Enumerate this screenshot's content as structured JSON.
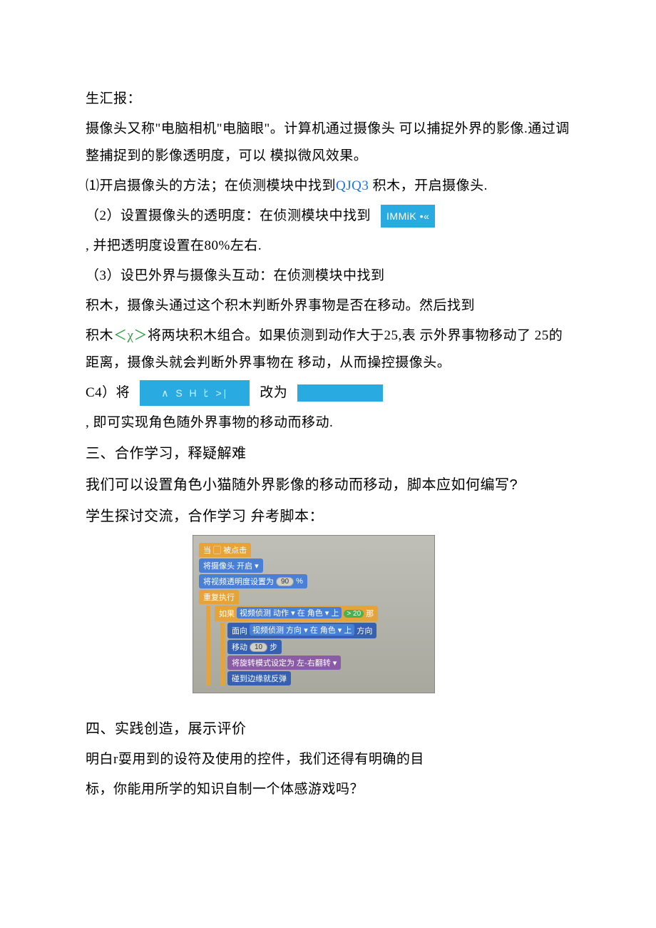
{
  "p1": "生汇报：",
  "p2": "摄像头又称\"电脑相机\"电脑眼\"。计算机通过摄像头 可以捕捉外界的影像.通过调整捕捉到的影像透明度，可以 模拟微风效果。",
  "p3_a": "⑴开启摄像头的方法；在侦测模块中找到",
  "p3_link": "QJQ3",
  "p3_b": " 积木，开启摄像头.",
  "p4_a": "（2）设置摄像头的透明度：在侦测模块中找到",
  "p4_badge": "IMMiK •«",
  "p5": ", 并把透明度设置在80%左右.",
  "p6": "（3）设巴外界与摄像头互动：在侦测模块中找到",
  "p7": "积木，摄像头通过这个积木判断外界事物是否在移动。然后找到",
  "p8_a": "积木",
  "p8_green": "＜χ＞",
  "p8_b": "将两块积木组合。如果侦测到动作大于25,表 示外界事物移动了 25的距离，摄像头就会判断外界事物在 移动，从而操控摄像头。",
  "p9_a": "C4）将",
  "p9_block1": "∧ S H ﾋ  >|",
  "p9_b": "改为",
  "p10": ", 即可实现角色随外界事物的移动而移动.",
  "h3": "三、合作学习，释疑解难",
  "p11": "我们可以设置角色小猫随外界影像的移动而移动，脚本应如何编写?",
  "p12": "学生探讨交流，合作学习 弁考脚本：",
  "h4": "四、实践创造，展示评价",
  "p13": "明白r耍用到的设符及使用的控件，我们还得有明确的目",
  "p14": "标，你能用所学的知识自制一个体感游戏吗？",
  "script_blocks": {
    "b1": "当 ▢ 被点击",
    "b2": "将摄像头 开启 ▾",
    "b3_a": "将视频透明度设置为",
    "b3_v": "90",
    "b3_b": "%",
    "b4": "重复执行",
    "b5_a": "如果",
    "b5_b": "视频侦测 动作 ▾ 在 角色 ▾ 上",
    "b5_c": "> 20",
    "b5_d": "那",
    "b6_a": "面向",
    "b6_b": "视频侦测 方向 ▾ 在 角色 ▾ 上",
    "b6_c": "方向",
    "b7_a": "移动",
    "b7_v": "10",
    "b7_b": "步",
    "b8": "将旋转模式设定为 左-右翻转 ▾",
    "b9": "碰到边缘就反弹"
  }
}
